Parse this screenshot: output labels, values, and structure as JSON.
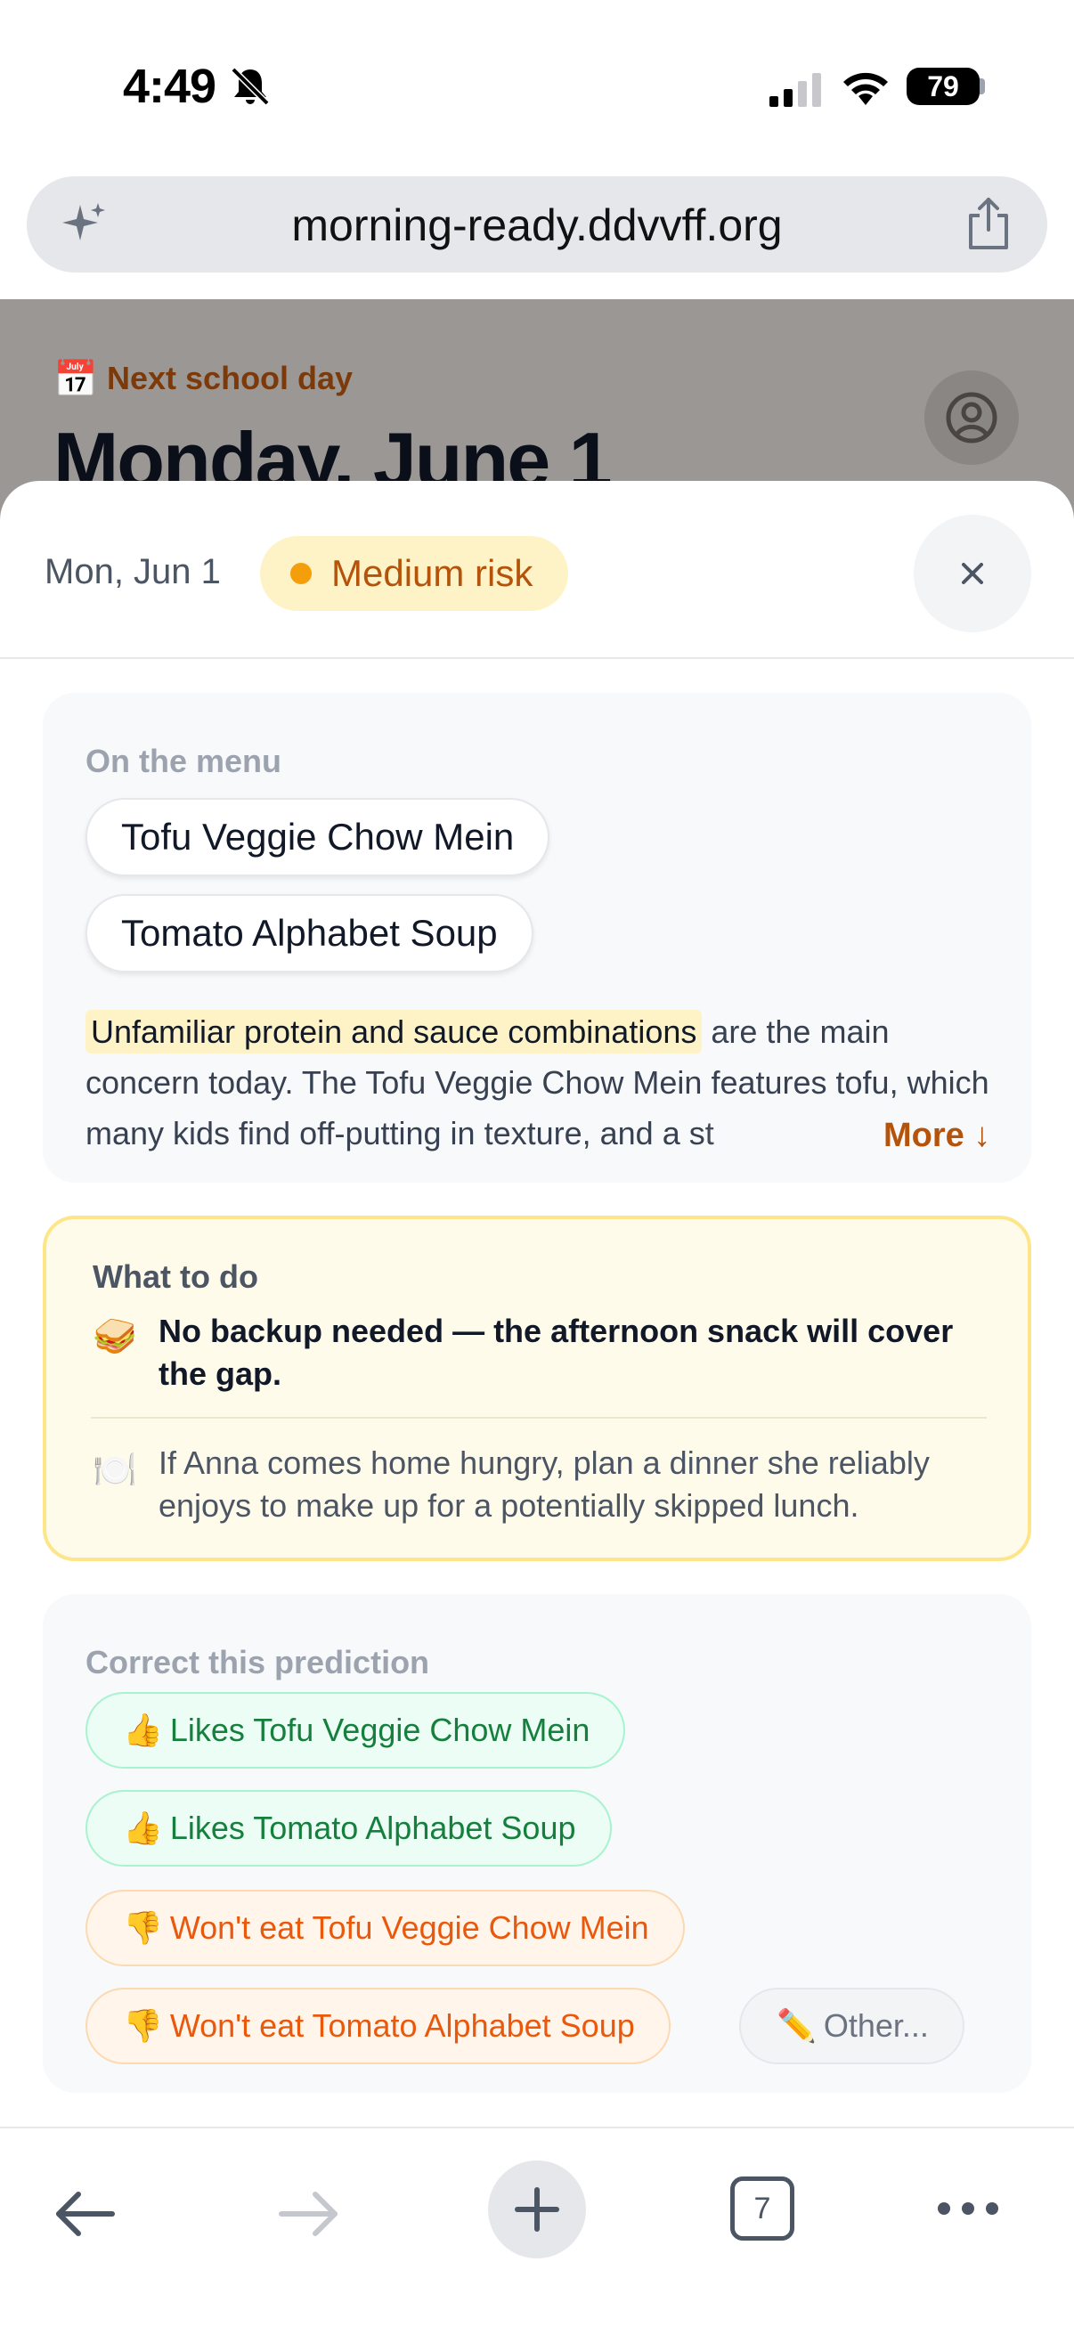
{
  "status_bar": {
    "time": "4:49",
    "battery": "79"
  },
  "browser": {
    "url": "morning-ready.ddvvff.org",
    "tab_count": "7"
  },
  "background_page": {
    "calendar_icon": "📅",
    "next_label": "Next school day",
    "title": "Monday, June 1"
  },
  "sheet": {
    "date": "Mon, Jun 1",
    "risk_label": "Medium risk",
    "menu": {
      "label": "On the menu",
      "items": [
        "Tofu Veggie Chow Mein",
        "Tomato Alphabet Soup"
      ],
      "highlight": "Unfamiliar protein and sauce combinations",
      "description": " are the main concern today. The Tofu Veggie Chow Mein features tofu, which many kids find off-putting in texture, and a st",
      "more": "More ↓"
    },
    "todo": {
      "label": "What to do",
      "items": [
        {
          "icon": "🥪",
          "text": "No backup needed — the afternoon snack will cover the gap."
        },
        {
          "icon": "🍽️",
          "text": "If Anna comes home hungry, plan a dinner she reliably enjoys to make up for a potentially skipped lunch."
        }
      ]
    },
    "correct": {
      "label": "Correct this prediction",
      "options": [
        {
          "emoji": "👍",
          "text": "Likes Tofu Veggie Chow Mein"
        },
        {
          "emoji": "👍",
          "text": "Likes Tomato Alphabet Soup"
        },
        {
          "emoji": "👎",
          "text": "Won't eat Tofu Veggie Chow Mein"
        },
        {
          "emoji": "👎",
          "text": "Won't eat Tomato Alphabet Soup"
        },
        {
          "emoji": "✏️",
          "text": "Other..."
        }
      ]
    }
  },
  "colors": {
    "risk_accent": "#f59e0b",
    "like": "#15803d",
    "dislike": "#ea580c"
  }
}
